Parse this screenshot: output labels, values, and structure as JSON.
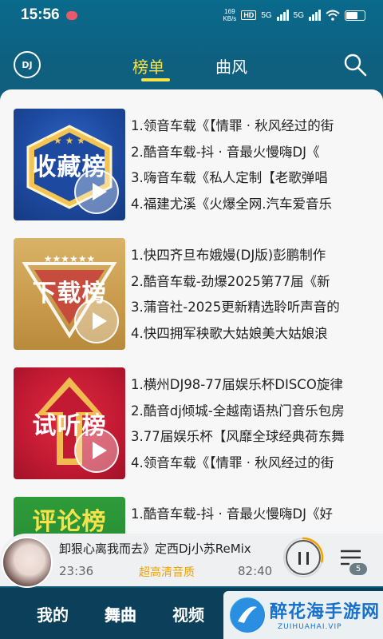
{
  "status": {
    "time": "15:56",
    "speed_top": "169",
    "speed_bottom": "KB/s",
    "hd": "HD",
    "net1": "5G",
    "net2": "5G"
  },
  "header": {
    "logo": "DJ",
    "tabs": [
      {
        "label": "榜单",
        "active": true
      },
      {
        "label": "曲风",
        "active": false
      }
    ],
    "accent": "#f6e24a"
  },
  "charts": [
    {
      "cover_title": "收藏榜",
      "tracks": [
        "1.领音车载《【情罪 · 秋风经过的街",
        "2.酷音车载-抖 · 音最火慢嗨DJ《",
        "3.嗨音车载《私人定制【老歌弹唱",
        "4.福建尤溪《火爆全网.汽车爱音乐"
      ]
    },
    {
      "cover_title": "下载榜",
      "tracks": [
        "1.快四齐旦布娥嫚(DJ版)彭鹏制作",
        "2.酷音车载-劲爆2025第77届《新",
        "3.蒲音社-2025更新精选聆听声音的",
        "4.快四拥军秧歌大姑娘美大姑娘浪"
      ]
    },
    {
      "cover_title": "试听榜",
      "tracks": [
        "1.横州DJ98-77届娱乐杯DISCO旋律",
        "2.酷音dj倾城-全越南语热门音乐包房",
        "3.77届娱乐杯【风靡全球经典荷东舞",
        "4.领音车载《【情罪 · 秋风经过的街"
      ]
    },
    {
      "cover_title": "评论榜",
      "tracks": [
        "1.酷音车载-抖 · 音最火慢嗨DJ《好"
      ]
    }
  ],
  "player": {
    "song": "卸狠心离我而去》定西Dj小苏ReMix",
    "current_time": "23:36",
    "quality": "超高清音质",
    "total_time": "82:40",
    "queue_count": "5",
    "progress": 0.285
  },
  "nav": {
    "items": [
      {
        "label": "我的"
      },
      {
        "label": "舞曲",
        "active": true
      },
      {
        "label": "视频"
      }
    ]
  },
  "watermark": {
    "title": "醉花海手游网",
    "sub": "ZUIHUAHAI.VIP"
  }
}
